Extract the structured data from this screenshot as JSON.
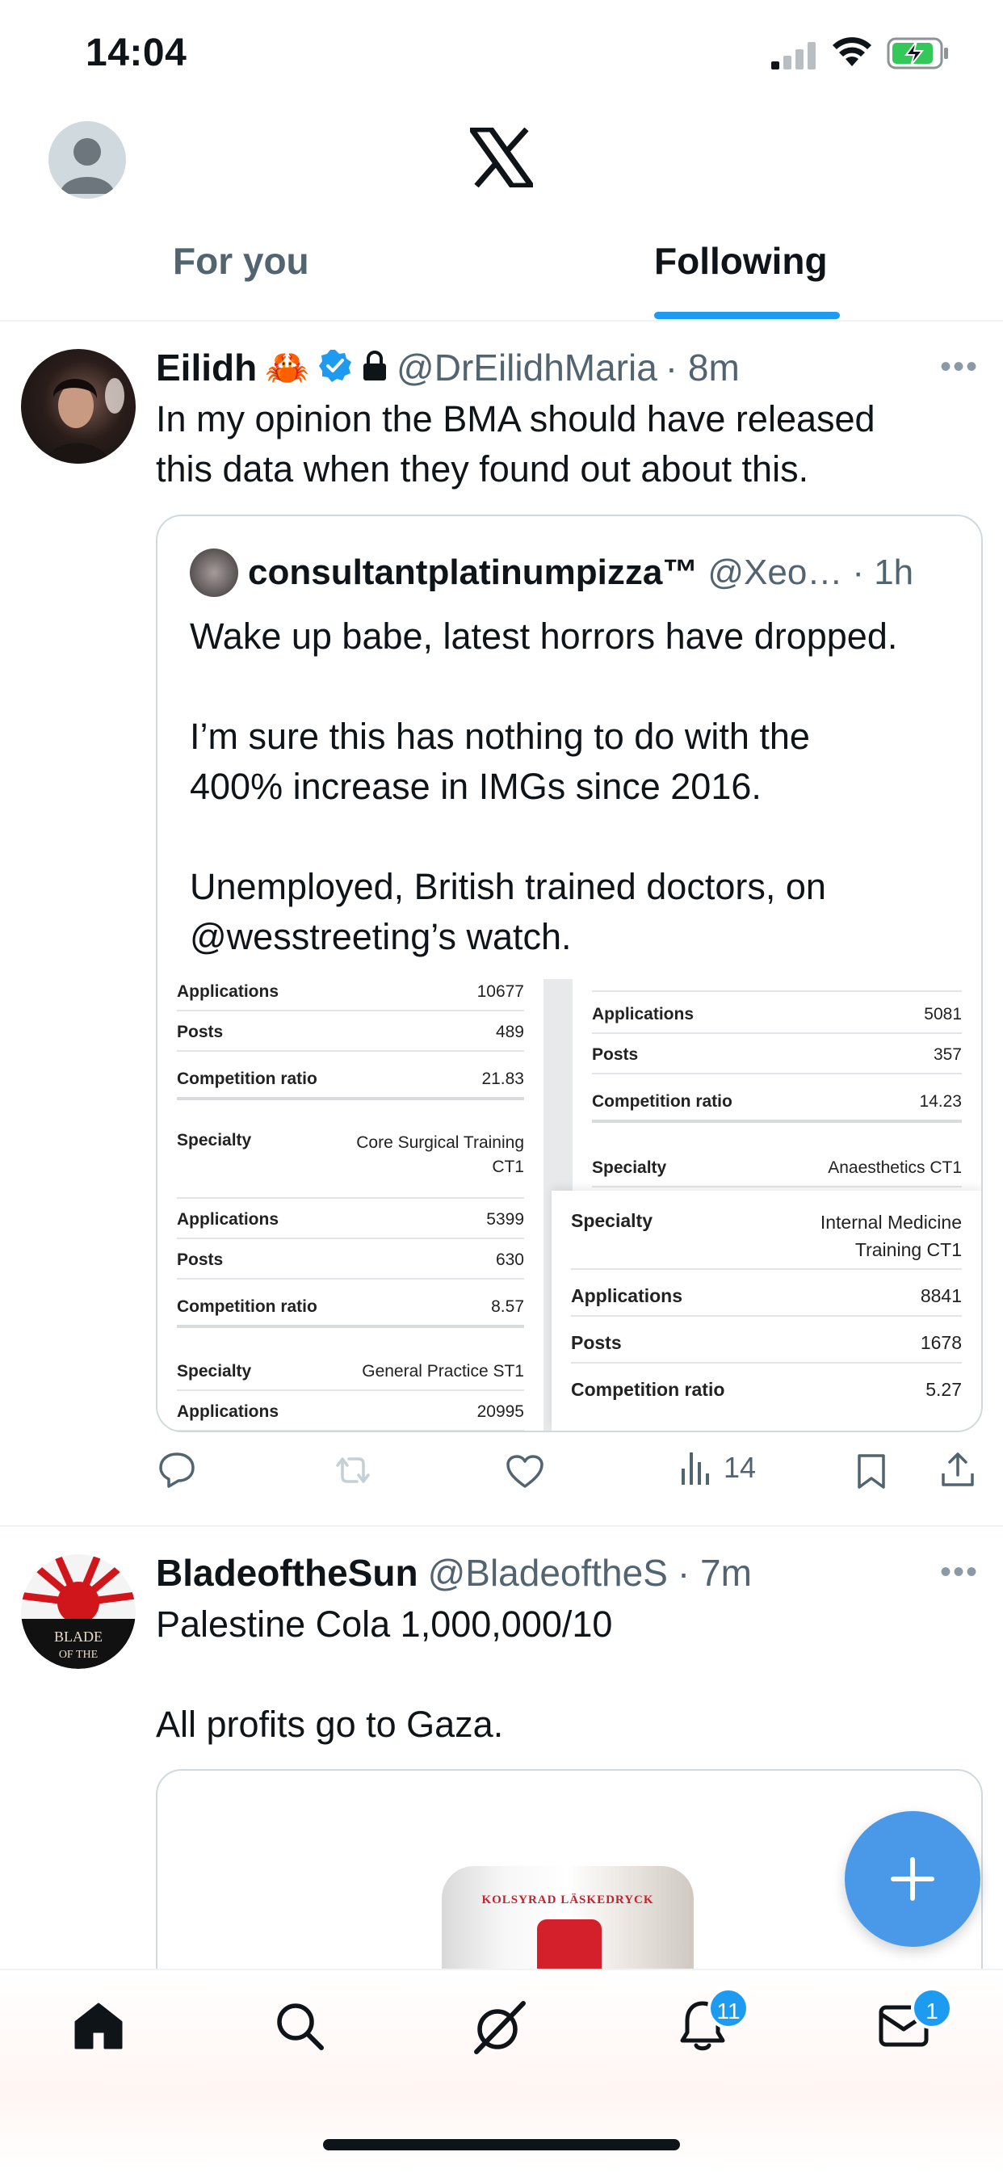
{
  "status_bar": {
    "time": "14:04"
  },
  "header": {
    "logo": "X",
    "tabs": [
      {
        "label": "For you"
      },
      {
        "label": "Following"
      }
    ]
  },
  "tweets": [
    {
      "name": "Eilidh",
      "emoji": "🦀",
      "handle": "@DrEilidhMaria",
      "time": "· 8m",
      "text": "In my opinion the BMA should have released\nthis data when they found out about this.",
      "quote": {
        "name": "consultantplatinumpizza™",
        "handle": "@Xeo…",
        "time": "· 1h",
        "text": "Wake up babe, latest horrors have dropped.\n\nI’m sure this has nothing to do with the\n400% increase in IMGs since 2016.\n\nUnemployed, British trained doctors, on\n@wesstreeting’s watch."
      },
      "table_left": [
        {
          "k": "Applications",
          "v": "10677"
        },
        {
          "k": "Posts",
          "v": "489"
        },
        {
          "k": "Competition ratio",
          "v": "21.83"
        },
        {
          "k": "Specialty",
          "v": "Core Surgical Training CT1"
        },
        {
          "k": "Applications",
          "v": "5399"
        },
        {
          "k": "Posts",
          "v": "630"
        },
        {
          "k": "Competition ratio",
          "v": "8.57"
        },
        {
          "k": "Specialty",
          "v": "General Practice ST1"
        },
        {
          "k": "Applications",
          "v": "20995"
        }
      ],
      "table_right_top": [
        {
          "k": "Applications",
          "v": "5081"
        },
        {
          "k": "Posts",
          "v": "357"
        },
        {
          "k": "Competition ratio",
          "v": "14.23"
        },
        {
          "k": "Specialty",
          "v": "Anaesthetics CT1"
        }
      ],
      "table_right_bottom": [
        {
          "k": "Specialty",
          "v": "Internal Medicine Training CT1"
        },
        {
          "k": "Applications",
          "v": "8841"
        },
        {
          "k": "Posts",
          "v": "1678"
        },
        {
          "k": "Competition ratio",
          "v": "5.27"
        }
      ],
      "views": "14"
    },
    {
      "name": "BladeoftheSun",
      "handle": "@BladeoftheS",
      "time": "· 7m",
      "text": "Palestine Cola 1,000,000/10\n\nAll profits go to Gaza.",
      "can_text": "KOLSYRAD LÄSKEDRYCK"
    }
  ],
  "nav": {
    "notifications_badge": "11",
    "messages_badge": "1"
  },
  "colors": {
    "accent": "#1d9bf0",
    "fab": "#4a99e9",
    "secondary_text": "#536471"
  }
}
